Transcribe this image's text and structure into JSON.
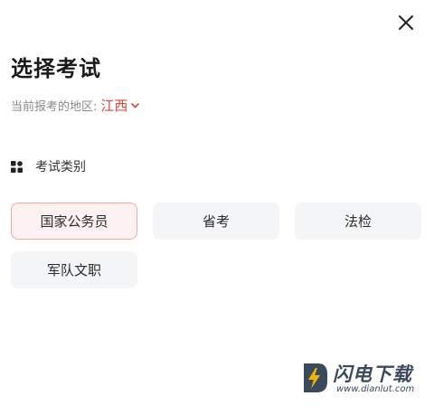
{
  "dialog": {
    "title": "选择考试",
    "close_icon": "close-icon"
  },
  "region": {
    "label": "当前报考的地区:",
    "value": "江西",
    "accent_color": "#e0443a"
  },
  "section": {
    "icon": "grid-icon",
    "title": "考试类别"
  },
  "options": [
    {
      "label": "国家公务员",
      "selected": true
    },
    {
      "label": "省考",
      "selected": false
    },
    {
      "label": "法检",
      "selected": false
    },
    {
      "label": "军队文职",
      "selected": false
    }
  ],
  "watermark": {
    "name": "闪电下载",
    "url": "www.dianlut.com"
  }
}
